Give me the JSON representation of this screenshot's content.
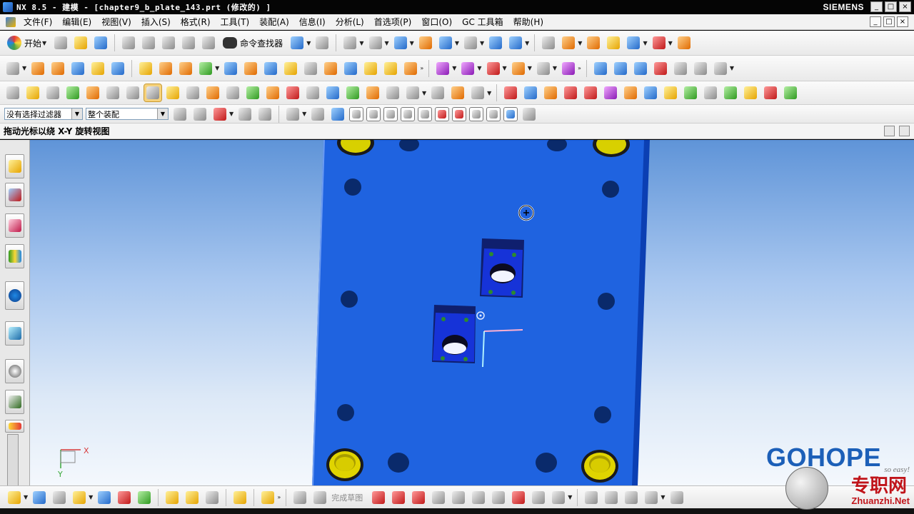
{
  "window": {
    "title": "NX 8.5 - 建模 - [chapter9_b_plate_143.prt (修改的) ]",
    "brand": "SIEMENS",
    "controls": [
      "_",
      "□",
      "×"
    ]
  },
  "menubar": {
    "items": [
      "文件(F)",
      "编辑(E)",
      "视图(V)",
      "插入(S)",
      "格式(R)",
      "工具(T)",
      "装配(A)",
      "信息(I)",
      "分析(L)",
      "首选项(P)",
      "窗口(O)",
      "GC 工具箱",
      "帮助(H)"
    ],
    "controls": [
      "_",
      "□",
      "×"
    ]
  },
  "toolbar1": {
    "start_label": "开始",
    "command_finder_label": "命令查找器"
  },
  "selection_bar": {
    "filter_value": "没有选择过滤器",
    "scope_value": "整个装配"
  },
  "cue_line": {
    "text": "拖动光标以绕 X-Y 旋转视图"
  },
  "bottom_toolbar": {
    "finish_sketch_label": "完成草图"
  },
  "watermark": {
    "brand": "GOHOPE",
    "site_cn": "专职网",
    "site_url": "Zhuanzhi.Net",
    "slogan": "so easy!"
  },
  "triad": {
    "x_label": "X",
    "y_label": "Y"
  },
  "colors": {
    "plate_blue": "#1f63e0",
    "viewport_top": "#5f94d8",
    "viewport_bottom": "#f4f8fd",
    "bolt_yellow": "#d8d000"
  }
}
